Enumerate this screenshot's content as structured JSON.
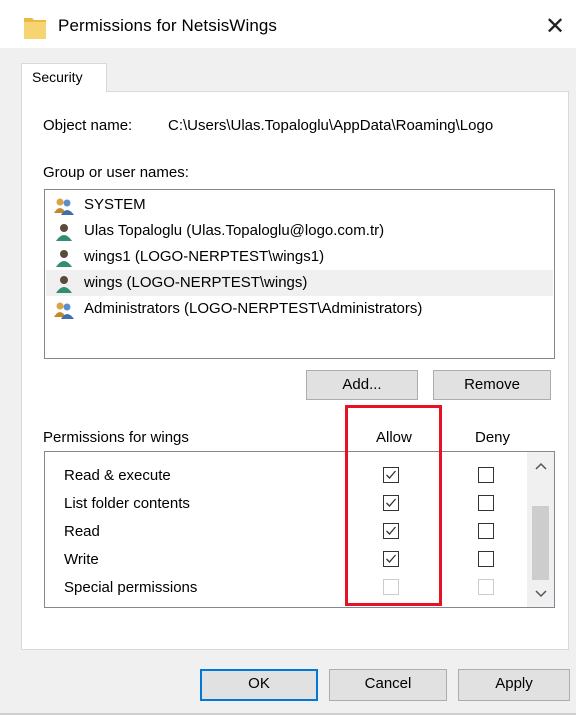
{
  "window": {
    "title": "Permissions for NetsisWings",
    "close_glyph": "✕"
  },
  "tabs": [
    {
      "label": "Security",
      "active": true
    }
  ],
  "object": {
    "label": "Object name:",
    "value": "C:\\Users\\Ulas.Topaloglu\\AppData\\Roaming\\Logo"
  },
  "groups": {
    "label": "Group or user names:",
    "items": [
      {
        "name": "SYSTEM",
        "icon": "group-users-icon",
        "selected": false
      },
      {
        "name": "Ulas Topaloglu (Ulas.Topaloglu@logo.com.tr)",
        "icon": "user-icon",
        "selected": false
      },
      {
        "name": "wings1 (LOGO-NERPTEST\\wings1)",
        "icon": "user-icon",
        "selected": false
      },
      {
        "name": "wings (LOGO-NERPTEST\\wings)",
        "icon": "user-icon",
        "selected": true
      },
      {
        "name": "Administrators (LOGO-NERPTEST\\Administrators)",
        "icon": "group-users-icon",
        "selected": false
      }
    ]
  },
  "buttons": {
    "add": "Add...",
    "remove": "Remove",
    "ok": "OK",
    "cancel": "Cancel",
    "apply": "Apply"
  },
  "permissions": {
    "label": "Permissions for wings",
    "allow_header": "Allow",
    "deny_header": "Deny",
    "items": [
      {
        "name": "Read & execute",
        "allow": true,
        "deny": false,
        "enabled": true
      },
      {
        "name": "List folder contents",
        "allow": true,
        "deny": false,
        "enabled": true
      },
      {
        "name": "Read",
        "allow": true,
        "deny": false,
        "enabled": true
      },
      {
        "name": "Write",
        "allow": true,
        "deny": false,
        "enabled": true
      },
      {
        "name": "Special permissions",
        "allow": false,
        "deny": false,
        "enabled": false
      }
    ]
  },
  "colors": {
    "highlight": "#e81123",
    "primary_border": "#0078d7",
    "selected_row": "#f0f0f0"
  }
}
